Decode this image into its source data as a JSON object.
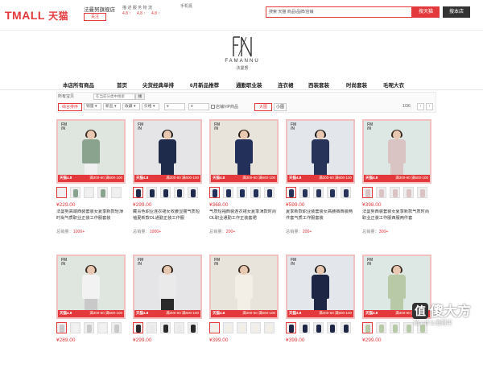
{
  "header": {
    "logo": "TMALL",
    "logo_cn": "天猫",
    "shop_name": "法曼努旗舰店",
    "follow": "关注",
    "ratings_label": "描 述  服 务  物 流",
    "ratings": [
      "4.8 ↑",
      "4.8 ↑",
      "4.8 ↑"
    ],
    "mobile": "手机逛",
    "search_value": "搜索 天猫 商品/品牌/店铺",
    "search_tmall": "搜天猫",
    "search_shop": "搜本店"
  },
  "brand": {
    "name": "FAMANNU",
    "name_cn": "法曼努"
  },
  "nav": {
    "items": [
      "本店所有商品",
      "首页",
      "尖货经典单排",
      "6月新品推荐",
      "通勤职业装",
      "连衣裙",
      "西装套装",
      "时尚套装",
      "毛呢大衣"
    ]
  },
  "filter": {
    "scope": "所有宝贝",
    "search_placeholder": "在当前分类中搜索",
    "search_btn": "搜",
    "sort_default": "综合排序",
    "dropdowns": [
      "销量",
      "新品",
      "收藏",
      "价格"
    ],
    "price_from": "¥",
    "price_to": "¥",
    "vip": "店铺VIP商品",
    "view_big": "大图",
    "view_small": "小图",
    "page_info": "1/36",
    "prev": "‹",
    "next": "›"
  },
  "products": [
    {
      "price": "¥229.00",
      "title": "法曼努高端西装套装女夏季新款轻薄时尚气质职业正装工作服套装",
      "sales_label": "总销量：",
      "sales": "1000+",
      "tag1": "天猫4.8",
      "tag2": "满300-60  满600-100"
    },
    {
      "price": "¥299.00",
      "title": "藏青色职业连衣裙女收腰显瘦气质短袖夏新款OL通勤正装工作服",
      "sales_label": "总销量：",
      "sales": "1000+",
      "tag1": "天猫4.8",
      "tag2": "满300-60  满600-100"
    },
    {
      "price": "¥368.00",
      "title": "气质短袖西装连衣裙女夏季薄款时尚OL职业通勤工作正装套裙",
      "sales_label": "总销量：",
      "sales": "200+",
      "tag1": "天猫4.8",
      "tag2": "满300-60  满600-100"
    },
    {
      "price": "¥599.00",
      "title": "夏季新款职业装套装女高腰裤西装两件套气质工作服套装",
      "sales_label": "总销量：",
      "sales": "200+",
      "tag1": "天猫4.8",
      "tag2": "满300-60  满600-100"
    },
    {
      "price": "¥398.00",
      "title": "法曼努西装套装女夏季新款气质时尚职业正装工作服西服两件套",
      "sales_label": "总销量：",
      "sales": "300+",
      "tag1": "天猫4.8",
      "tag2": "满300-60  满600-100"
    },
    {
      "price": "¥289.00",
      "title": "",
      "sales_label": "",
      "sales": "",
      "tag1": "天猫4.8",
      "tag2": "满300-60  满600-100"
    },
    {
      "price": "¥299.00",
      "title": "",
      "sales_label": "",
      "sales": "",
      "tag1": "天猫4.8",
      "tag2": "满300-60  满600-100"
    },
    {
      "price": "¥399.00",
      "title": "",
      "sales_label": "",
      "sales": "",
      "tag1": "天猫4.8",
      "tag2": "满300-60  满600-100"
    },
    {
      "price": "¥399.00",
      "title": "",
      "sales_label": "",
      "sales": "",
      "tag1": "天猫4.8",
      "tag2": "满300-60  满600-100"
    },
    {
      "price": "¥299.00",
      "title": "",
      "sales_label": "",
      "sales": "",
      "tag1": "天猫4.8",
      "tag2": "满300-60  满600-100"
    }
  ],
  "watermark": {
    "text": "傻大方",
    "sub": "值 | 什么值得买"
  },
  "colors": {
    "accent": "#e4393c",
    "nav_text": "#222222"
  }
}
